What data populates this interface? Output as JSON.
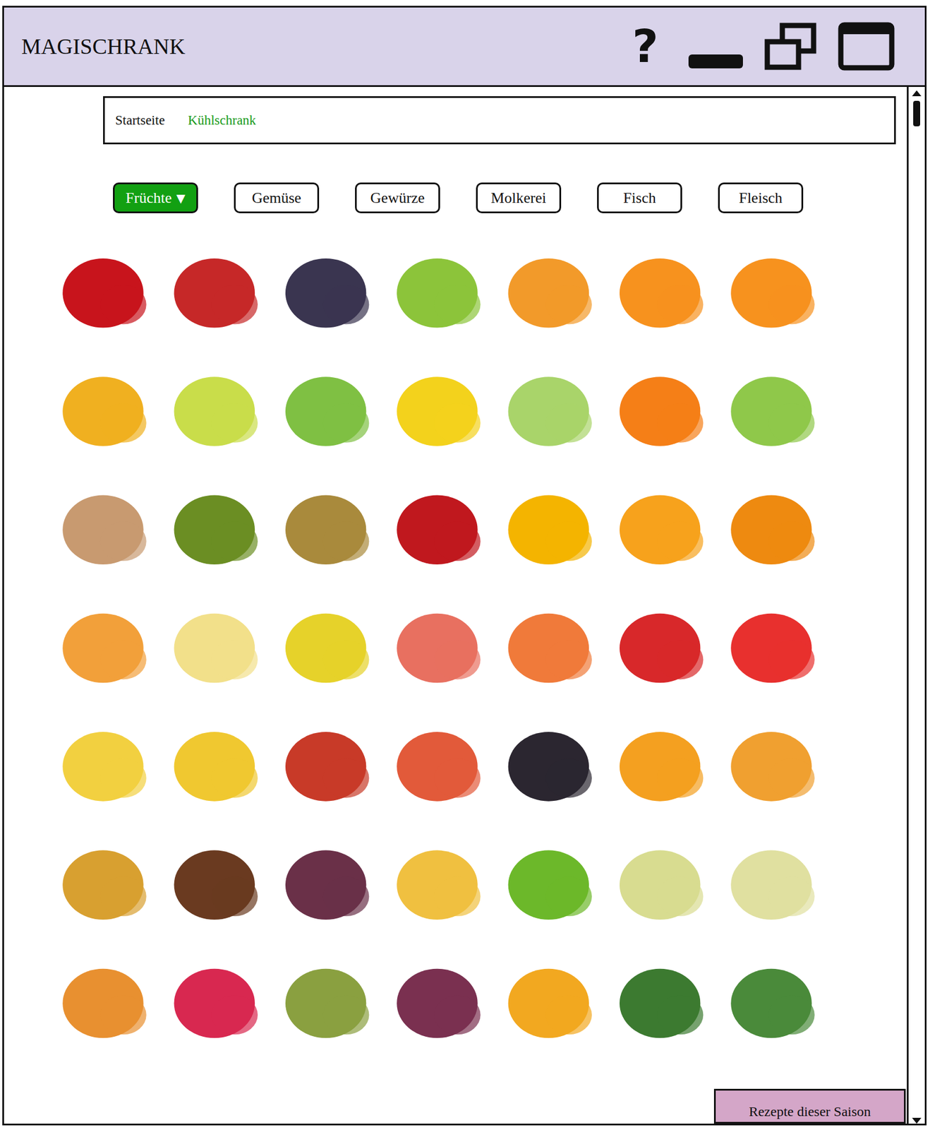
{
  "window": {
    "title": "MAGISCHRANK",
    "help": "?"
  },
  "nav": [
    {
      "label": "Startseite",
      "selected": false
    },
    {
      "label": "Kühlschrank",
      "selected": true
    }
  ],
  "categories": [
    {
      "label": "Früchte",
      "selected": true,
      "marker": "▼"
    },
    {
      "label": "Gemüse",
      "selected": false,
      "marker": ""
    },
    {
      "label": "Gewürze",
      "selected": false,
      "marker": ""
    },
    {
      "label": "Molkerei",
      "selected": false,
      "marker": ""
    },
    {
      "label": "Fisch",
      "selected": false,
      "marker": ""
    },
    {
      "label": "Fleisch",
      "selected": false,
      "marker": ""
    }
  ],
  "footer_button": "Rezepte dieser Saison"
}
